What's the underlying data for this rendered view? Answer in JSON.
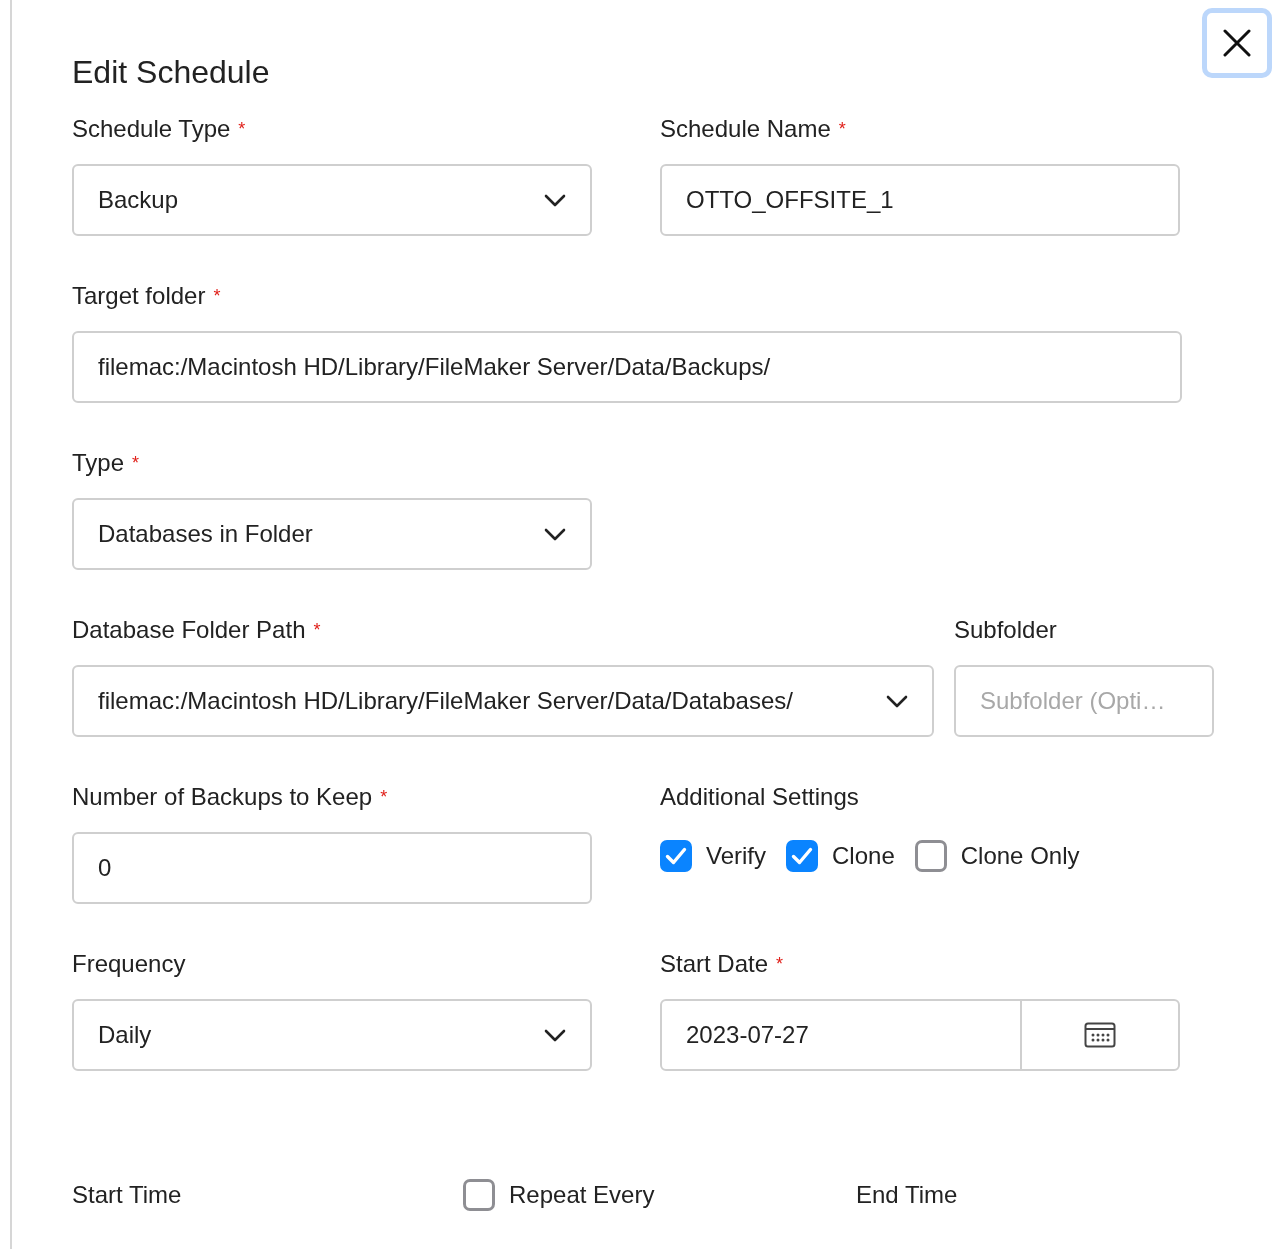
{
  "dialog": {
    "title": "Edit Schedule",
    "close_button": {
      "focused": true
    }
  },
  "schedule_type": {
    "label": "Schedule Type",
    "required_mark": "*",
    "value": "Backup"
  },
  "schedule_name": {
    "label": "Schedule Name",
    "required_mark": "*",
    "value": "OTTO_OFFSITE_1"
  },
  "target_folder": {
    "label": "Target folder",
    "required_mark": "*",
    "value": "filemac:/Macintosh HD/Library/FileMaker Server/Data/Backups/"
  },
  "type": {
    "label": "Type",
    "required_mark": "*",
    "value": "Databases in Folder"
  },
  "database_folder_path": {
    "label": "Database Folder Path",
    "required_mark": "*",
    "value": "filemac:/Macintosh HD/Library/FileMaker Server/Data/Databases/"
  },
  "subfolder": {
    "label": "Subfolder",
    "placeholder": "Subfolder (Opti…"
  },
  "backups_to_keep": {
    "label": "Number of Backups to Keep",
    "required_mark": "*",
    "value": "0"
  },
  "additional_settings": {
    "label": "Additional Settings",
    "options": [
      {
        "label": "Verify",
        "checked": true
      },
      {
        "label": "Clone",
        "checked": true
      },
      {
        "label": "Clone Only",
        "checked": false
      }
    ]
  },
  "frequency": {
    "label": "Frequency",
    "value": "Daily"
  },
  "start_date": {
    "label": "Start Date",
    "required_mark": "*",
    "value": "2023-07-27"
  },
  "start_time": {
    "label": "Start Time"
  },
  "repeat_every": {
    "label": "Repeat Every",
    "checked": false
  },
  "end_time": {
    "label": "End Time"
  }
}
